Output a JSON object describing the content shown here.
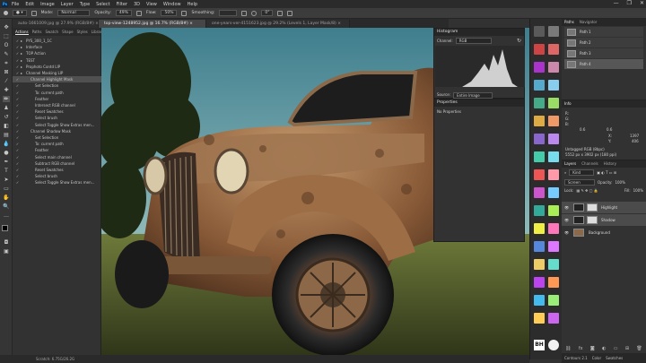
{
  "menu": [
    "File",
    "Edit",
    "Image",
    "Layer",
    "Type",
    "Select",
    "Filter",
    "3D",
    "View",
    "Window",
    "Help"
  ],
  "app_logo": "Ps",
  "window_controls": [
    "—",
    "❐",
    "✕"
  ],
  "options": {
    "mode_label": "Mode:",
    "mode_value": "Normal",
    "opacity_label": "Opacity:",
    "opacity_value": "49%",
    "flow_label": "Flow:",
    "flow_value": "50%",
    "smoothing_label": "Smoothing:",
    "angle_value": "0°"
  },
  "tabs": [
    "auto-1661009.jpg @ 27.9% (RGB/8#) ×",
    "top-view-1248952.jpg @ 16.7% (RGB/8#) ×",
    "one-years-ver-4151623.jpg @ 29.2% (Levels 1, Layer Mask/8) ×"
  ],
  "actions_panel": {
    "tabs": [
      "Actions",
      "Paths",
      "Swatch",
      "Shape",
      "Styles",
      "Libraries"
    ],
    "items": [
      {
        "label": "PYS_300_1_1C",
        "indent": 1,
        "folder": true
      },
      {
        "label": "Interface",
        "indent": 1,
        "folder": true
      },
      {
        "label": "TOP Action",
        "indent": 1,
        "folder": true
      },
      {
        "label": "TEST",
        "indent": 1,
        "folder": true
      },
      {
        "label": "Prophoto Contd LIP",
        "indent": 1,
        "folder": true
      },
      {
        "label": "Channel Masking LIP",
        "indent": 1,
        "folder": true
      },
      {
        "label": "Channel Highlight Mask",
        "indent": 2,
        "folder": false,
        "selected": true
      },
      {
        "label": "Set Selection",
        "indent": 3
      },
      {
        "label": "To: current path",
        "indent": 3
      },
      {
        "label": "Feather",
        "indent": 3
      },
      {
        "label": "Intersect RGB channel",
        "indent": 3
      },
      {
        "label": "Reset Swatches",
        "indent": 3
      },
      {
        "label": "Select brush",
        "indent": 3
      },
      {
        "label": "Select Toggle Show Extras men...",
        "indent": 3
      },
      {
        "label": "Channel Shadow Mask",
        "indent": 2
      },
      {
        "label": "Set Selection",
        "indent": 3
      },
      {
        "label": "To: current path",
        "indent": 3
      },
      {
        "label": "Feather",
        "indent": 3
      },
      {
        "label": "Select main channel",
        "indent": 3
      },
      {
        "label": "Subtract RGB channel",
        "indent": 3
      },
      {
        "label": "Reset Swatches",
        "indent": 3
      },
      {
        "label": "Select brush",
        "indent": 3
      },
      {
        "label": "Select Toggle Show Extras men...",
        "indent": 3
      }
    ]
  },
  "histogram": {
    "title": "Histogram",
    "channel_label": "Channel:",
    "channel_value": "RGB",
    "source_label": "Source:",
    "source_value": "Entire Image"
  },
  "properties": {
    "title": "Properties",
    "subtitle": "No Properties"
  },
  "paths_panel": {
    "tabs": [
      "Paths",
      "Navigator"
    ],
    "items": [
      "Path 1",
      "Path 2",
      "Path 3",
      "Path 4"
    ],
    "selected": 3
  },
  "info_panel": {
    "title": "Info",
    "r_label": "R:",
    "g_label": "G:",
    "b_label": "B:",
    "x_label": "X:",
    "y_label": "Y:",
    "x_value": "1397",
    "y_value": "406",
    "c_value": "0.6",
    "k_value": "0.6",
    "doc_line1": "Untagged RGB (8bpc)",
    "doc_line2": "5552 px x 3902 px (180 ppi)"
  },
  "layers_panel": {
    "tabs": [
      "Layers",
      "Channels",
      "History"
    ],
    "filter_label": "Kind",
    "blend_mode": "Screen",
    "opacity_label": "Opacity:",
    "opacity_value": "100%",
    "lock_label": "Lock:",
    "fill_label": "Fill:",
    "fill_value": "100%",
    "layers": [
      {
        "name": "Highlight",
        "selected": true
      },
      {
        "name": "Shadow",
        "selected": true
      },
      {
        "name": "Background",
        "selected": false
      }
    ]
  },
  "bottom_tabs": [
    "Contours 2.1",
    "Color",
    "Swatches"
  ],
  "status": "Scratch: 6.75G/26.2G",
  "strip_badge": "BH"
}
